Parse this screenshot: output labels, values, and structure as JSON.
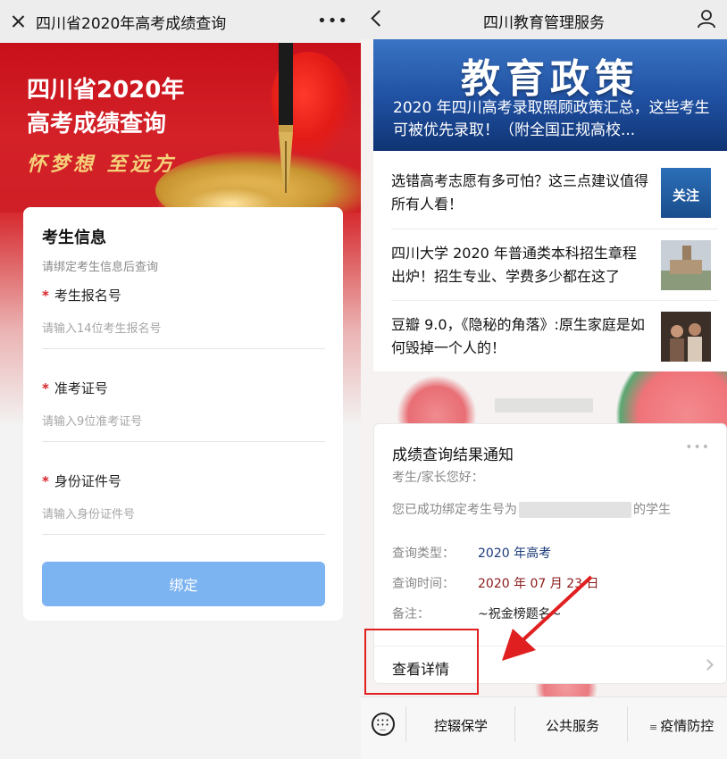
{
  "left": {
    "nav": {
      "title": "四川省2020年高考成绩查询",
      "more": "•••"
    },
    "banner": {
      "title_line1": "四川省2020年",
      "title_line2": "高考成绩查询",
      "slogan": "怀梦想 至远方"
    },
    "form": {
      "heading": "考生信息",
      "subtitle": "请绑定考生信息后查询",
      "required_mark": "*",
      "fields": [
        {
          "label": "考生报名号",
          "placeholder": "请输入14位考生报名号"
        },
        {
          "label": "准考证号",
          "placeholder": "请输入9位准考证号"
        },
        {
          "label": "身份证件号",
          "placeholder": "请输入身份证件号"
        }
      ],
      "submit_label": "绑定"
    }
  },
  "right": {
    "nav": {
      "title": "四川教育管理服务"
    },
    "hero": {
      "big_text": "教育政策",
      "headline": "2020 年四川高考录取照顾政策汇总，这些考生可被优先录取！（附全国正规高校..."
    },
    "articles": [
      {
        "title": "选错高考志愿有多可怕？这三点建议值得所有人看！",
        "thumb_text": "关注"
      },
      {
        "title": "四川大学 2020 年普通类本科招生章程出炉！招生专业、学费多少都在这了",
        "thumb_text": ""
      },
      {
        "title": "豆瓣 9.0，《隐秘的角落》:原生家庭是如何毁掉一个人的！",
        "thumb_text": ""
      }
    ],
    "notice": {
      "title": "成绩查询结果通知",
      "more": "•••",
      "greeting": "考生/家长您好：",
      "bound_prefix": "您已成功绑定考生号为",
      "bound_suffix": "的学生",
      "rows": [
        {
          "key": "查询类型：",
          "value": "2020 年高考"
        },
        {
          "key": "查询时间：",
          "value": "2020 年 07 月 23 日"
        },
        {
          "key": "备注：",
          "value": "~祝金榜题名~"
        }
      ],
      "detail_label": "查看详情"
    },
    "tabbar": {
      "items": [
        {
          "label": "控辍保学",
          "icon": ""
        },
        {
          "label": "公共服务",
          "icon": ""
        },
        {
          "label": "疫情防控",
          "icon": "≡"
        }
      ]
    },
    "colors": {
      "accent_red": "#e02020",
      "button_blue": "#7cb3f1"
    }
  }
}
